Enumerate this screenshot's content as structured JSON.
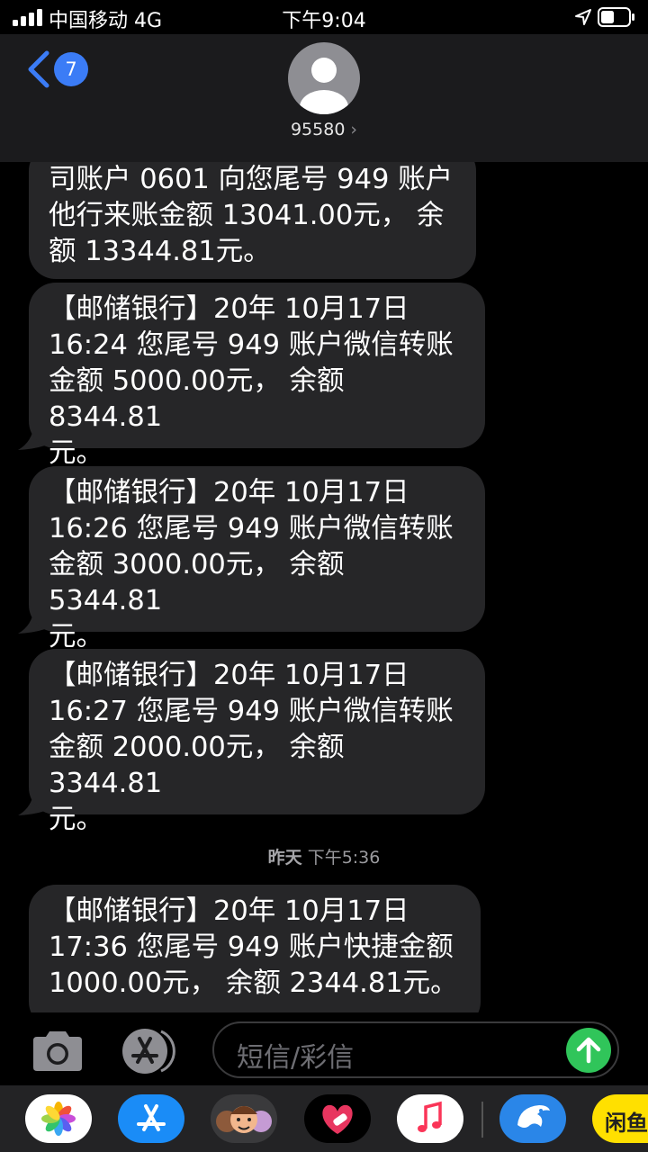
{
  "status_bar": {
    "carrier": "中国移动 4G",
    "time": "下午9:04",
    "icons": [
      "signal-icon",
      "location-arrow-icon",
      "battery-icon"
    ]
  },
  "header": {
    "back_badge": "7",
    "contact": "95580",
    "icons": [
      "back-chevron-icon",
      "avatar-icon",
      "chevron-right-icon"
    ]
  },
  "messages": [
    {
      "text": "司账户 0601 向您尾号 949 账户\n他行来账金额 13041.00元， 余\n额 13344.81元。"
    },
    {
      "text": "【邮储银行】20年 10月17日\n16:24 您尾号 949 账户微信转账\n金额 5000.00元， 余额 8344.81\n元。"
    },
    {
      "text": "【邮储银行】20年 10月17日\n16:26 您尾号 949 账户微信转账\n金额 3000.00元， 余额 5344.81\n元。"
    },
    {
      "text": "【邮储银行】20年 10月17日\n16:27 您尾号 949 账户微信转账\n金额 2000.00元， 余额 3344.81\n元。"
    },
    {
      "text": "【邮储银行】20年 10月17日\n17:36 您尾号 949 账户快捷金额\n1000.00元， 余额 2344.81元。"
    }
  ],
  "timestamp": {
    "day": "昨天",
    "time": "下午5:36"
  },
  "input_bar": {
    "placeholder": "短信/彩信",
    "icons": [
      "camera-icon",
      "app-store-icon",
      "send-arrow-icon"
    ],
    "colors": {
      "send": "#30c55a"
    }
  },
  "dock": {
    "apps": [
      "photos-icon",
      "app-store-icon",
      "memoji-icon",
      "heart-sticker-icon",
      "music-icon",
      "dolphin-app-icon",
      "xianyu-icon"
    ],
    "xianyu_label": "闲鱼"
  },
  "colors": {
    "bubble": "#262628",
    "accent": "#3b7cf6"
  }
}
